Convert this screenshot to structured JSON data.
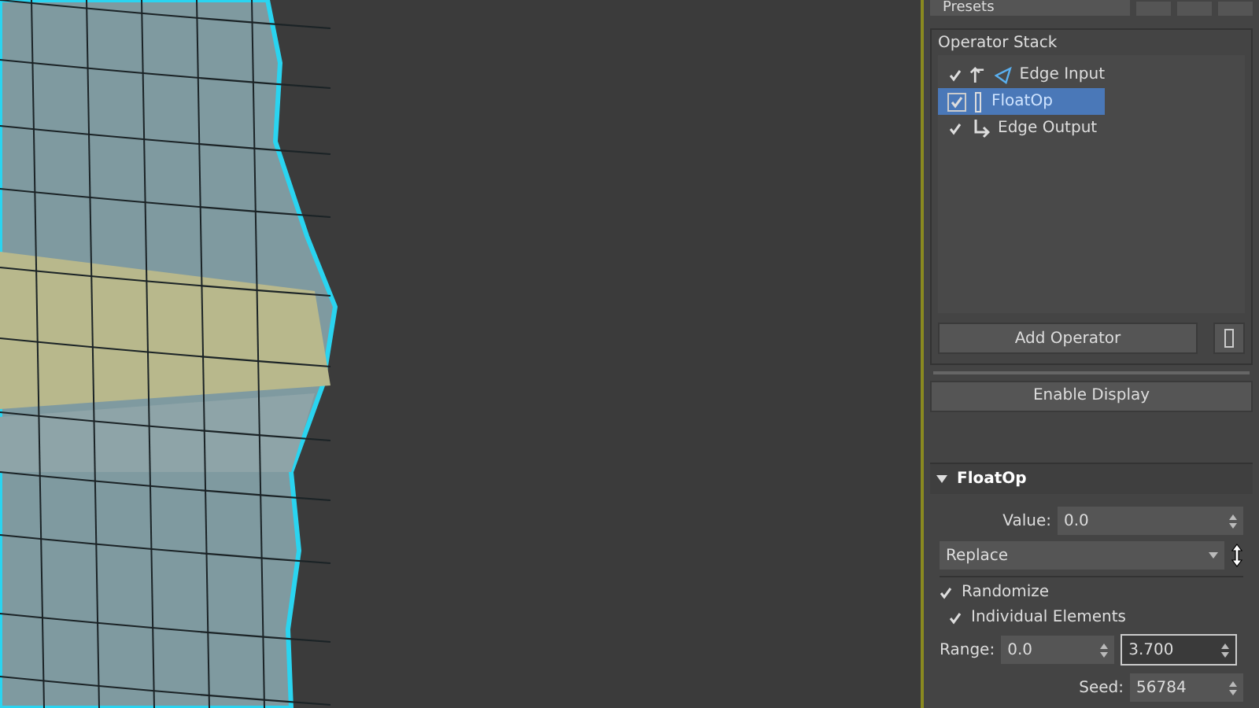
{
  "presets": {
    "label": "Presets"
  },
  "operator_stack": {
    "title": "Operator Stack",
    "items": [
      {
        "label": "Edge Input",
        "kind": "input",
        "checked": true,
        "selected": false
      },
      {
        "label": "FloatOp",
        "kind": "op",
        "checked": true,
        "selected": true
      },
      {
        "label": "Edge Output",
        "kind": "output",
        "checked": true,
        "selected": false
      }
    ],
    "add_button": "Add Operator"
  },
  "enable_display": "Enable Display",
  "rollout": {
    "title": "FloatOp",
    "expanded": true,
    "value_label": "Value:",
    "value": "0.0",
    "mode": "Replace",
    "randomize": {
      "label": "Randomize",
      "checked": true
    },
    "individual": {
      "label": "Individual Elements",
      "checked": true
    },
    "range_label": "Range:",
    "range_min": "0.0",
    "range_max": "3.700",
    "seed_label": "Seed:",
    "seed": "56784"
  }
}
